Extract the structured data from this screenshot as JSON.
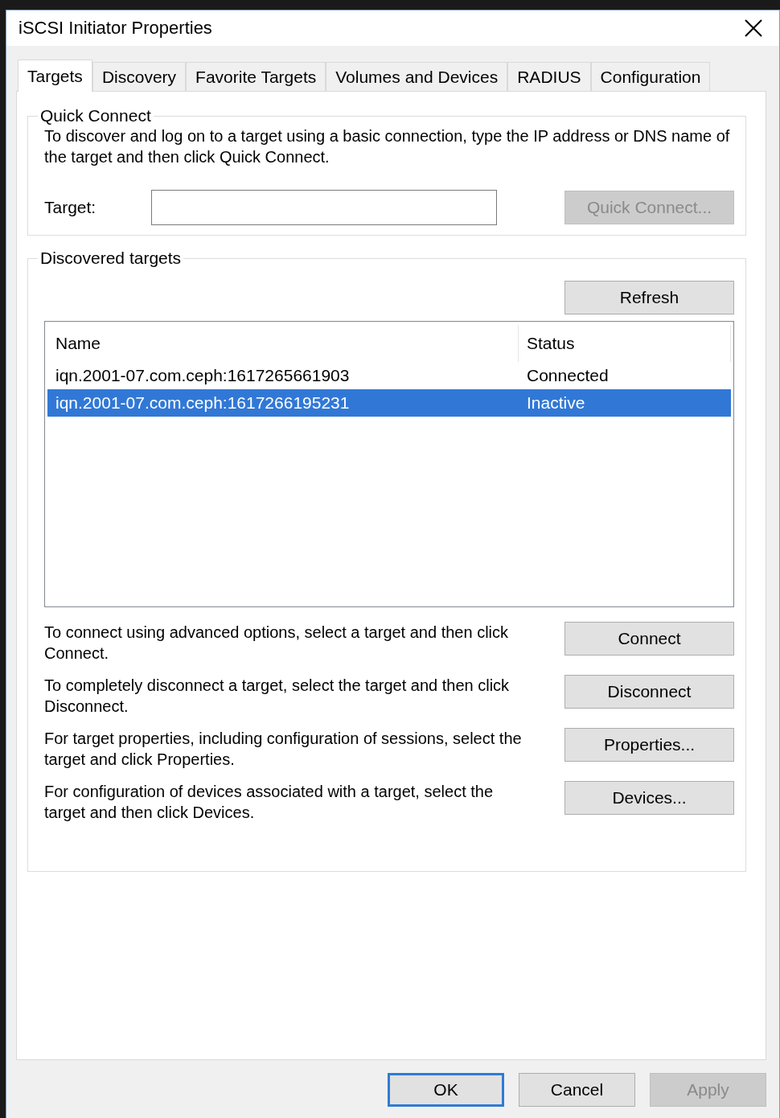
{
  "window": {
    "title": "iSCSI Initiator Properties"
  },
  "tabs": [
    {
      "label": "Targets",
      "selected": true
    },
    {
      "label": "Discovery",
      "selected": false
    },
    {
      "label": "Favorite Targets",
      "selected": false
    },
    {
      "label": "Volumes and Devices",
      "selected": false
    },
    {
      "label": "RADIUS",
      "selected": false
    },
    {
      "label": "Configuration",
      "selected": false
    }
  ],
  "quick_connect": {
    "legend": "Quick Connect",
    "description": "To discover and log on to a target using a basic connection, type the IP address or DNS name of the target and then click Quick Connect.",
    "target_label": "Target:",
    "button": {
      "label": "Quick Connect...",
      "disabled": true
    }
  },
  "discovered_targets": {
    "legend": "Discovered targets",
    "refresh_button": {
      "label": "Refresh",
      "disabled": false
    },
    "columns": [
      "Name",
      "Status"
    ],
    "rows": [
      {
        "name": "iqn.2001-07.com.ceph:1617265661903",
        "status": "Connected",
        "selected": false
      },
      {
        "name": "iqn.2001-07.com.ceph:1617266195231",
        "status": "Inactive",
        "selected": true
      }
    ],
    "actions": [
      {
        "description": "To connect using advanced options, select a target and then click Connect.",
        "button": "Connect"
      },
      {
        "description": "To completely disconnect a target, select the target and then click Disconnect.",
        "button": "Disconnect"
      },
      {
        "description": "For target properties, including configuration of sessions, select the target and click Properties.",
        "button": "Properties..."
      },
      {
        "description": "For configuration of devices associated with a target, select the target and then click Devices.",
        "button": "Devices..."
      }
    ]
  },
  "footer_buttons": [
    {
      "label": "OK",
      "default": true,
      "disabled": false
    },
    {
      "label": "Cancel",
      "default": false,
      "disabled": false
    },
    {
      "label": "Apply",
      "default": false,
      "disabled": true
    }
  ]
}
